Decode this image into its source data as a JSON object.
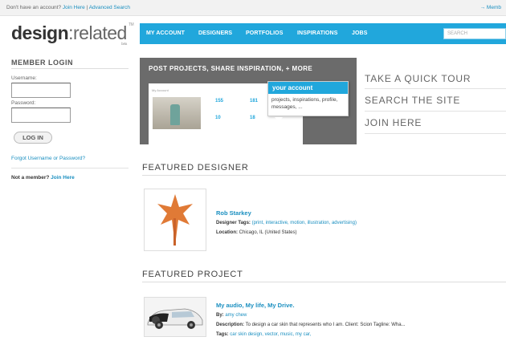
{
  "topbar": {
    "no_account": "Don't have an account?",
    "join_here": "Join Here",
    "divider": "|",
    "advanced_search": "Advanced Search",
    "right_link": "→ Memb"
  },
  "logo": {
    "design": "design",
    "colon_related": ":related",
    "tm": "TM",
    "beta": "beta"
  },
  "nav": {
    "items": [
      "MY ACCOUNT",
      "DESIGNERS",
      "PORTFOLIOS",
      "INSPIRATIONS",
      "JOBS"
    ],
    "search_placeholder": "SEARCH"
  },
  "login": {
    "title": "MEMBER LOGIN",
    "username_label": "Username:",
    "password_label": "Password:",
    "button": "LOG IN",
    "forgot": "Forgot Username or Password?",
    "not_member": "Not a member?",
    "join": "Join Here"
  },
  "hero": {
    "title": "POST PROJECTS, SHARE INSPIRATION, + MORE",
    "card_heading": "My Account",
    "stats": [
      "155",
      "181",
      "10",
      "18"
    ],
    "callout_title": "your account",
    "callout_body": "projects, inspirations, profile, messages, ..."
  },
  "quick_links": [
    "TAKE A QUICK TOUR",
    "SEARCH THE SITE",
    "JOIN HERE"
  ],
  "featured_designer": {
    "section_title": "FEATURED DESIGNER",
    "name": "Rob Starkey",
    "tags_label": "Designer Tags:",
    "tags": "(print, interactive, motion, illustration, advertising)",
    "location_label": "Location:",
    "location": "Chicago, IL (United States)"
  },
  "featured_project": {
    "section_title": "FEATURED PROJECT",
    "title": "My audio, My life, My Drive.",
    "by_label": "By:",
    "by": "amy chew",
    "desc_label": "Description:",
    "desc": "To design a car skin that represents who I am. Client: Scion Tagline: Wha...",
    "tags_label": "Tags:",
    "tags": "car skin design, vector, music, my car,"
  },
  "colors": {
    "accent": "#21a7dc",
    "link": "#1a8fc0",
    "hero_bg": "#6b6b6b"
  }
}
